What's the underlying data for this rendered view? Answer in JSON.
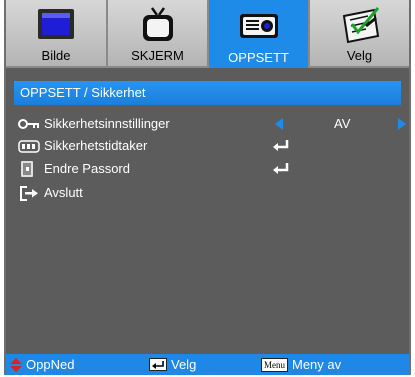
{
  "tabs": [
    {
      "label": "Bilde",
      "icon": "monitor-icon",
      "active": false
    },
    {
      "label": "SKJERM",
      "icon": "tv-icon",
      "active": false
    },
    {
      "label": "OPPSETT",
      "icon": "projector-icon",
      "active": true
    },
    {
      "label": "Velg",
      "icon": "options-checklist-icon",
      "active": false
    }
  ],
  "breadcrumb": "OPPSETT / Sikkerhet",
  "menu": {
    "items": [
      {
        "label": "Sikkerhetsinnstillinger",
        "icon": "key-icon",
        "control": "selector",
        "value": "AV"
      },
      {
        "label": "Sikkerhetstidtaker",
        "icon": "timer-icon",
        "control": "enter"
      },
      {
        "label": "Endre Passord",
        "icon": "password-icon",
        "control": "enter"
      },
      {
        "label": "Avslutt",
        "icon": "exit-icon",
        "control": "none"
      }
    ]
  },
  "footer": {
    "nav_label": "OppNed",
    "select_label": "Velg",
    "menu_key": "Menu",
    "menu_label": "Meny av"
  },
  "colors": {
    "accent": "#1f8be8",
    "panel": "#5c5c5c",
    "tab_inactive": "#c4c4c4"
  }
}
